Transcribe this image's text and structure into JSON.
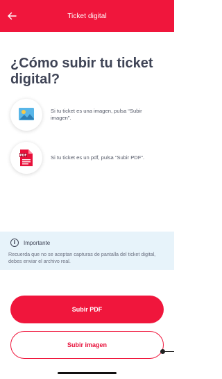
{
  "header": {
    "title": "Ticket digital",
    "back_icon": "arrow-left-icon",
    "color": "#f0163c"
  },
  "page": {
    "title": "¿Cómo subir tu ticket digital?"
  },
  "steps": [
    {
      "icon": "image-file-icon",
      "text": "Si tu ticket es una imagen, pulsa “Subir imagen”."
    },
    {
      "icon": "pdf-file-icon",
      "text": "Si tu ticket es un pdf, pulsa “Subir PDF”."
    }
  ],
  "info": {
    "icon": "info-icon",
    "title": "Importante",
    "body": "Recuerda que no se aceptan capturas de pantalla del ticket digital, debes enviar el archivo real.",
    "background": "#e7f3fa"
  },
  "buttons": {
    "upload_pdf": "Subir PDF",
    "upload_image": "Subir imagen"
  }
}
